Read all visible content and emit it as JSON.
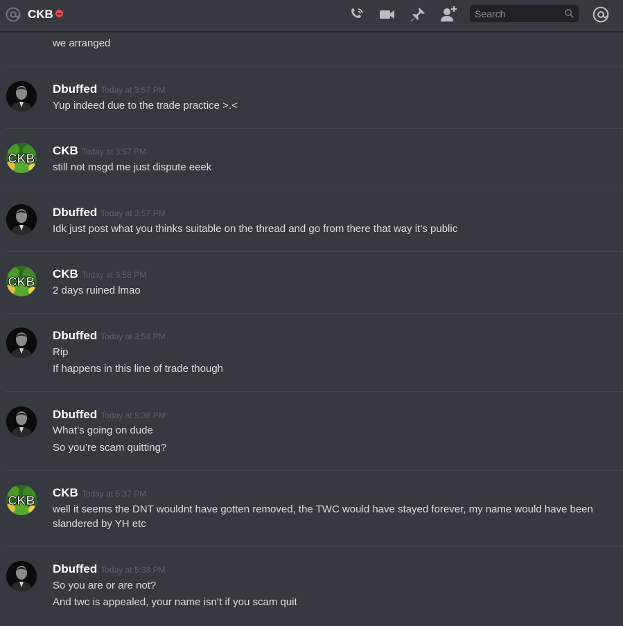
{
  "header": {
    "channel_name": "CKB",
    "status": "dnd",
    "search": {
      "placeholder": "Search",
      "value": ""
    }
  },
  "messages": [
    {
      "lines": [
        "we arranged"
      ]
    },
    {
      "author": "Dbuffed",
      "timestamp": "Today at 3:57 PM",
      "lines": [
        "Yup indeed due to the trade practice >.<"
      ]
    },
    {
      "author": "CKB",
      "timestamp": "Today at 3:57 PM",
      "lines": [
        "still not msgd me just dispute eeek"
      ]
    },
    {
      "author": "Dbuffed",
      "timestamp": "Today at 3:57 PM",
      "lines": [
        "Idk just post what you thinks suitable on the thread and go from there that way it’s public"
      ]
    },
    {
      "author": "CKB",
      "timestamp": "Today at 3:58 PM",
      "lines": [
        "2 days ruined lmao"
      ]
    },
    {
      "author": "Dbuffed",
      "timestamp": "Today at 3:58 PM",
      "lines": [
        "Rip",
        "If happens in this line of trade though"
      ]
    },
    {
      "author": "Dbuffed",
      "timestamp": "Today at 5:36 PM",
      "lines": [
        "What’s going on dude",
        "So you’re scam quitting?"
      ]
    },
    {
      "author": "CKB",
      "timestamp": "Today at 5:37 PM",
      "lines": [
        "well it seems the DNT wouldnt have gotten removed, the TWC would have stayed forever, my name would have been slandered by YH etc"
      ]
    },
    {
      "author": "Dbuffed",
      "timestamp": "Today at 5:38 PM",
      "lines": [
        "So you are or are not?",
        "And twc is appealed, your name isn’t if you scam quit"
      ]
    }
  ],
  "avatar_labels": {
    "ckb": "CKB"
  }
}
